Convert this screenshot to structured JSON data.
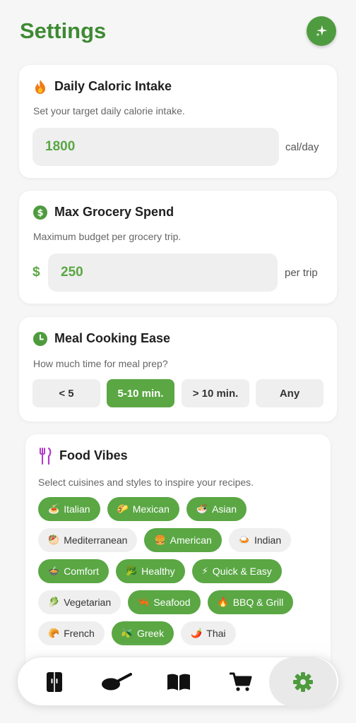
{
  "header": {
    "title": "Settings",
    "action_icon": "sparkle-icon"
  },
  "colors": {
    "accent": "#5aa744",
    "title": "#3e8a33"
  },
  "calories": {
    "title": "Daily Caloric Intake",
    "icon": "flame-icon",
    "description": "Set your target daily calorie intake.",
    "value": "1800",
    "unit": "cal/day"
  },
  "grocery": {
    "title": "Max Grocery Spend",
    "icon": "dollar-coin-icon",
    "description": "Maximum budget per grocery trip.",
    "currency": "$",
    "value": "250",
    "unit": "per trip"
  },
  "cooking": {
    "title": "Meal Cooking Ease",
    "icon": "clock-icon",
    "description": "How much time for meal prep?",
    "options": [
      "< 5",
      "5-10 min.",
      "> 10 min.",
      "Any"
    ],
    "selected": "5-10 min."
  },
  "vibes": {
    "title": "Food Vibes",
    "icon": "fork-knife-icon",
    "description": "Select cuisines and styles to inspire your recipes.",
    "chips": [
      {
        "emoji": "🍝",
        "label": "Italian",
        "selected": true
      },
      {
        "emoji": "🌮",
        "label": "Mexican",
        "selected": true
      },
      {
        "emoji": "🍜",
        "label": "Asian",
        "selected": true
      },
      {
        "emoji": "🥙",
        "label": "Mediterranean",
        "selected": false
      },
      {
        "emoji": "🍔",
        "label": "American",
        "selected": true
      },
      {
        "emoji": "🍛",
        "label": "Indian",
        "selected": false
      },
      {
        "emoji": "🍲",
        "label": "Comfort",
        "selected": true
      },
      {
        "emoji": "🥦",
        "label": "Healthy",
        "selected": true
      },
      {
        "emoji": "⚡",
        "label": "Quick & Easy",
        "selected": true
      },
      {
        "emoji": "🥬",
        "label": "Vegetarian",
        "selected": false
      },
      {
        "emoji": "🦐",
        "label": "Seafood",
        "selected": true
      },
      {
        "emoji": "🔥",
        "label": "BBQ & Grill",
        "selected": true
      },
      {
        "emoji": "🥐",
        "label": "French",
        "selected": false
      },
      {
        "emoji": "🫒",
        "label": "Greek",
        "selected": true
      },
      {
        "emoji": "🌶️",
        "label": "Thai",
        "selected": false
      }
    ]
  },
  "nav": {
    "items": [
      {
        "name": "fridge",
        "icon": "fridge-icon"
      },
      {
        "name": "cook",
        "icon": "frying-pan-icon"
      },
      {
        "name": "recipes",
        "icon": "book-icon"
      },
      {
        "name": "shopping",
        "icon": "cart-icon"
      },
      {
        "name": "settings",
        "icon": "gear-icon"
      }
    ],
    "active": "settings"
  }
}
